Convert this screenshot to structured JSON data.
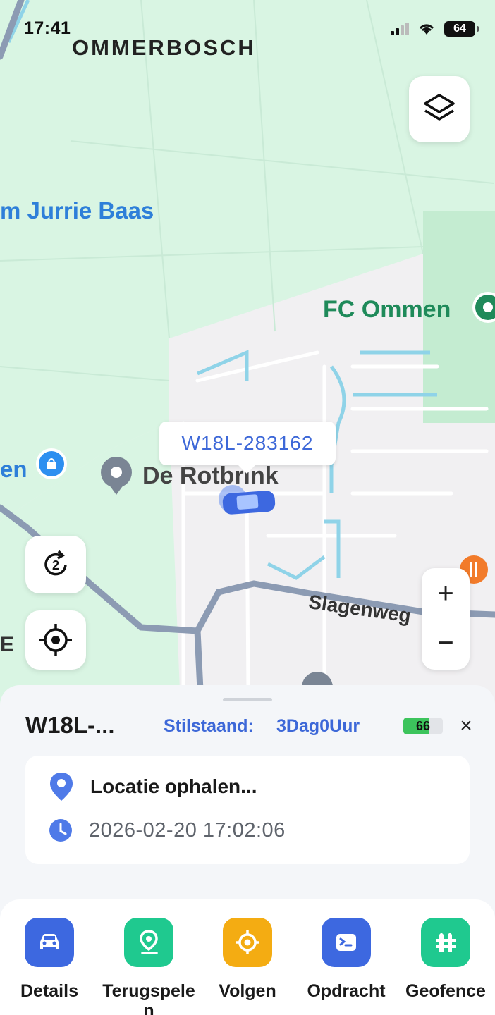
{
  "status_bar": {
    "time": "17:41",
    "battery": "64"
  },
  "map": {
    "labels": {
      "ommerbosch": "OMMERBOSCH",
      "jurrie": "m Jurrie Baas",
      "fc_ommen": "FC Ommen",
      "en": "en",
      "de_rotbrink": "De Rotbrink",
      "slagenweg": "Slagenweg",
      "e": "E"
    },
    "vehicle_id": "W18L-283162",
    "refresh_count": "2",
    "zoom_in": "+",
    "zoom_out": "−",
    "icons": [
      "layers-icon",
      "refresh-icon",
      "locate-icon",
      "shopping-poi-icon",
      "location-pin-icon",
      "restaurant-poi-icon",
      "car-icon"
    ]
  },
  "sheet": {
    "plate": "W18L-...",
    "idle_label": "Stilstaand:",
    "idle_value": "3Dag0Uur",
    "battery": 66,
    "close": "×",
    "location_text": "Locatie ophalen...",
    "timestamp": "2026-02-20 17:02:06"
  },
  "actions": [
    {
      "label": "Details",
      "color": "#3d68e0",
      "icon": "car-icon"
    },
    {
      "label": "Terugspelen",
      "color": "#1fc98f",
      "icon": "route-pin-icon"
    },
    {
      "label": "Volgen",
      "color": "#f4ac12",
      "icon": "target-icon"
    },
    {
      "label": "Opdracht",
      "color": "#3d68e0",
      "icon": "terminal-icon"
    },
    {
      "label": "Geofence",
      "color": "#1fc98f",
      "icon": "fence-icon"
    }
  ],
  "colors": {
    "accent": "#3d68d8",
    "map_green": "#d9f5e3",
    "map_urban": "#f1f0f2"
  }
}
